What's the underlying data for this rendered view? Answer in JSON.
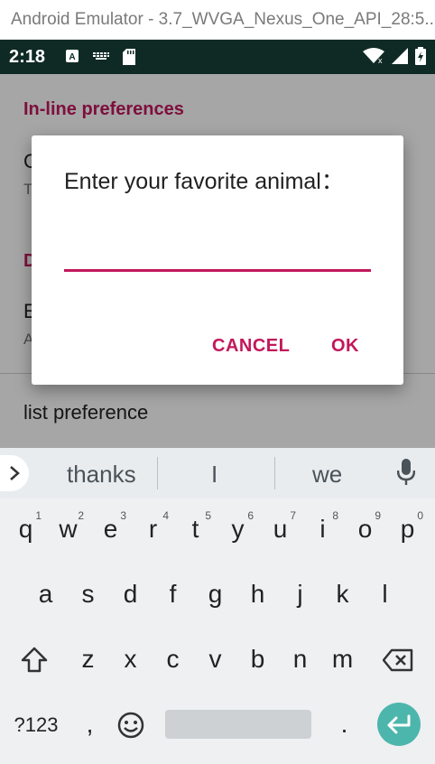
{
  "window": {
    "title": "Android Emulator - 3.7_WVGA_Nexus_One_API_28:5..."
  },
  "status_bar": {
    "time": "2:18",
    "icons_left": [
      "keyboard-a-icon",
      "keyboard-icon",
      "sd-card-icon"
    ],
    "icons_right": [
      "wifi-icon",
      "signal-icon",
      "battery-icon"
    ]
  },
  "app": {
    "category1": "In-line preferences",
    "item1_title": "C",
    "item1_summary": "T",
    "category2": "D",
    "item2_title": "E",
    "item2_summary": "A",
    "list_pref": "list preference"
  },
  "dialog": {
    "title": "Enter your favorite animal：",
    "input_value": "",
    "cancel": "CANCEL",
    "ok": "OK"
  },
  "keyboard": {
    "suggestions": [
      "thanks",
      "I",
      "we"
    ],
    "row1": [
      "q",
      "w",
      "e",
      "r",
      "t",
      "y",
      "u",
      "i",
      "o",
      "p"
    ],
    "row1_hints": [
      "1",
      "2",
      "3",
      "4",
      "5",
      "6",
      "7",
      "8",
      "9",
      "0"
    ],
    "row2": [
      "a",
      "s",
      "d",
      "f",
      "g",
      "h",
      "j",
      "k",
      "l"
    ],
    "row3": [
      "z",
      "x",
      "c",
      "v",
      "b",
      "n",
      "m"
    ],
    "symbols": "?123",
    "comma": ",",
    "period": ".",
    "accent": "#4db6ac"
  }
}
